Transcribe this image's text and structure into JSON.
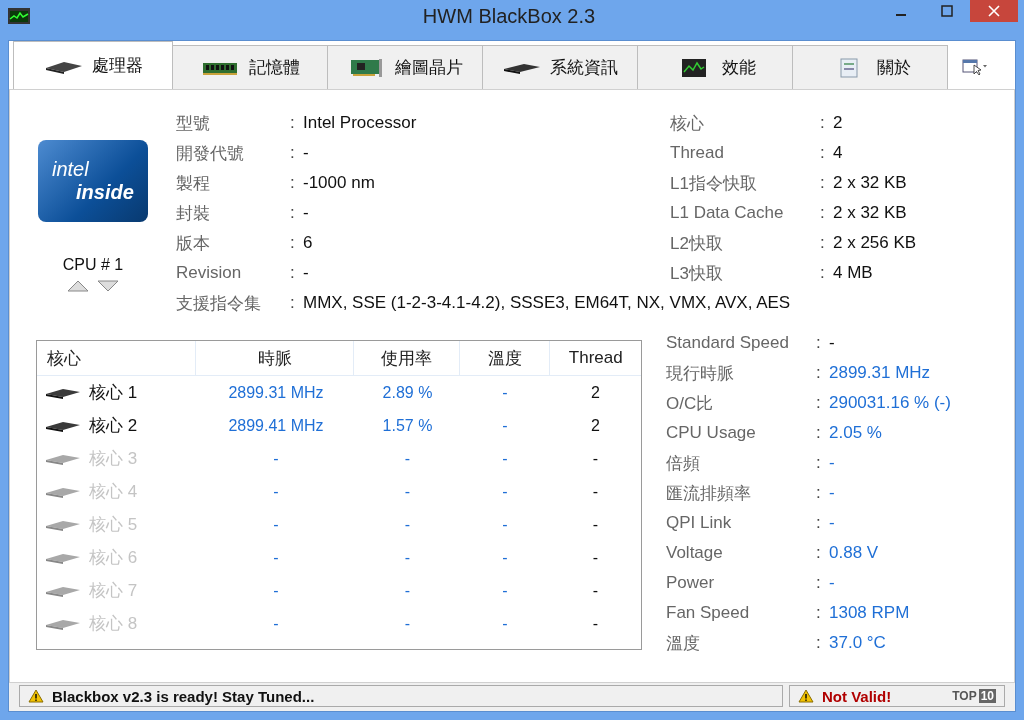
{
  "window": {
    "title": "HWM BlackBox 2.3"
  },
  "tabs": [
    {
      "label": "處理器",
      "kind": "cpu",
      "selected": true
    },
    {
      "label": "記憶體",
      "kind": "memory",
      "selected": false
    },
    {
      "label": "繪圖晶片",
      "kind": "gpu",
      "selected": false
    },
    {
      "label": "系統資訊",
      "kind": "chip",
      "selected": false
    },
    {
      "label": "效能",
      "kind": "monitor",
      "selected": false
    },
    {
      "label": "關於",
      "kind": "about",
      "selected": false
    }
  ],
  "logo": {
    "line_1": "intel",
    "line_2": "inside"
  },
  "cpu_selector": {
    "label": "CPU # 1"
  },
  "specs_left": [
    {
      "label": "型號",
      "value": "Intel Processor"
    },
    {
      "label": "開發代號",
      "value": "-"
    },
    {
      "label": "製程",
      "value": "-1000 nm"
    },
    {
      "label": "封裝",
      "value": "-"
    },
    {
      "label": "版本",
      "value": "6"
    },
    {
      "label": "Revision",
      "value": "-"
    }
  ],
  "specs_right": [
    {
      "label": "核心",
      "value": "2"
    },
    {
      "label": "Thread",
      "value": "4"
    },
    {
      "label": "L1指令快取",
      "value": "2 x 32 KB"
    },
    {
      "label": "L1 Data Cache",
      "value": "2 x 32 KB"
    },
    {
      "label": "L2快取",
      "value": "2 x 256 KB"
    },
    {
      "label": "L3快取",
      "value": "4 MB"
    }
  ],
  "instructions": {
    "label": "支援指令集",
    "value": "MMX, SSE (1-2-3-4.1-4.2), SSSE3, EM64T, NX, VMX, AVX, AES"
  },
  "cores_table": {
    "columns": [
      "核心",
      "時脈",
      "使用率",
      "溫度",
      "Thread"
    ],
    "rows": [
      {
        "active": true,
        "cells": [
          "核心 1",
          "2899.31 MHz",
          "2.89 %",
          "-",
          "2"
        ]
      },
      {
        "active": true,
        "cells": [
          "核心 2",
          "2899.41 MHz",
          "1.57 %",
          "-",
          "2"
        ]
      },
      {
        "active": false,
        "cells": [
          "核心 3",
          "-",
          "-",
          "-",
          "-"
        ]
      },
      {
        "active": false,
        "cells": [
          "核心 4",
          "-",
          "-",
          "-",
          "-"
        ]
      },
      {
        "active": false,
        "cells": [
          "核心 5",
          "-",
          "-",
          "-",
          "-"
        ]
      },
      {
        "active": false,
        "cells": [
          "核心 6",
          "-",
          "-",
          "-",
          "-"
        ]
      },
      {
        "active": false,
        "cells": [
          "核心 7",
          "-",
          "-",
          "-",
          "-"
        ]
      },
      {
        "active": false,
        "cells": [
          "核心 8",
          "-",
          "-",
          "-",
          "-"
        ]
      }
    ]
  },
  "sensors": [
    {
      "label": "Standard Speed",
      "value": "-",
      "live": false
    },
    {
      "label": "現行時脈",
      "value": "2899.31 MHz",
      "live": true
    },
    {
      "label": "O/C比",
      "value": "290031.16 % (-)",
      "live": true
    },
    {
      "label": "CPU Usage",
      "value": "2.05 %",
      "live": true
    },
    {
      "label": "倍頻",
      "value": "-",
      "live": true
    },
    {
      "label": "匯流排頻率",
      "value": "-",
      "live": true
    },
    {
      "label": "QPI Link",
      "value": "-",
      "live": true
    },
    {
      "label": "Voltage",
      "value": "0.88 V",
      "live": true
    },
    {
      "label": "Power",
      "value": "-",
      "live": true
    },
    {
      "label": "Fan Speed",
      "value": "1308 RPM",
      "live": true
    },
    {
      "label": "溫度",
      "value": "37.0 °C",
      "live": true
    }
  ],
  "separator": ":",
  "status_bar": {
    "message": "Blackbox v2.3 is ready! Stay Tuned...",
    "validity": "Not Valid!",
    "badge_1": "TOP",
    "badge_2": "10"
  }
}
